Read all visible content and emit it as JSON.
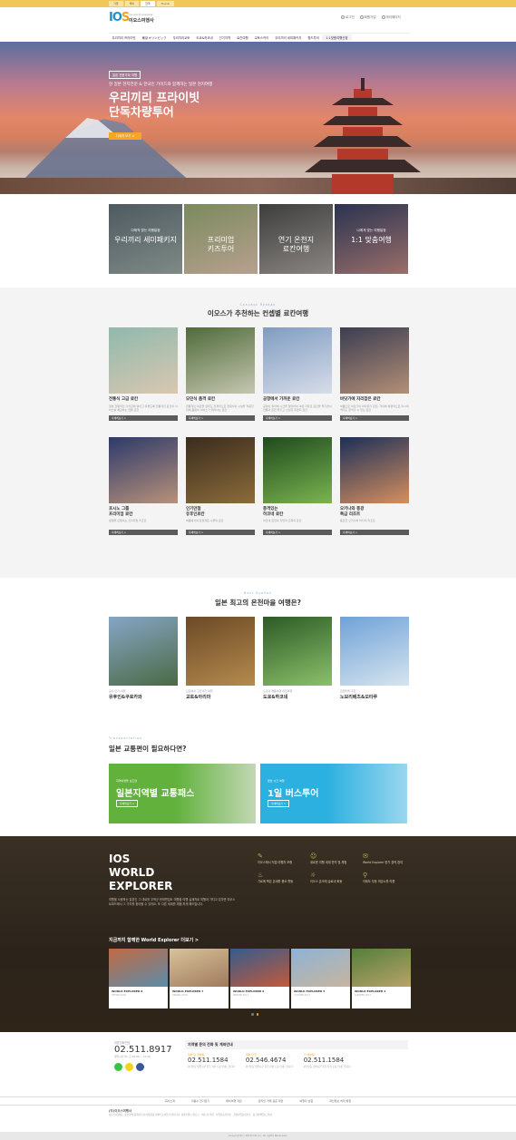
{
  "top_tabs": [
    "기업",
    "해외",
    "한국",
    "Tour/e"
  ],
  "logo": {
    "mark_a": "IO",
    "mark_b": "S",
    "sub1": "ios world explorer",
    "sub2": "이오스여행사"
  },
  "util": [
    "로그인",
    "회원가입",
    "마이페이지"
  ],
  "gnb": [
    "우리끼리 프라이빗",
    "東京オリンピック",
    "우리끼리교토",
    "도쿄&하코네",
    "인기지역",
    "료칸여행",
    "교토스카이",
    "우리끼리 세미패키지",
    "월드투어",
    "1:1맞춤여행신청"
  ],
  "hero": {
    "badge": "일본 전문가와 여행",
    "sub": "현 일본 현지전문 & 한국인 가이드와 함께하는 일본 현지여행",
    "title_l1": "우리끼리 프라이빗",
    "title_l2": "단독차량투어",
    "button": "자세히 보기 >"
  },
  "quick": [
    {
      "l1": "다채적 맞는 여행일정",
      "l2": "우리끼리 세미패키지",
      "c1": "#4d5a60",
      "c2": "#7f8a86"
    },
    {
      "l1": "",
      "l2": "프리미엄\n키즈투어",
      "c1": "#7a8a5c",
      "c2": "#b7a090"
    },
    {
      "l1": "",
      "l2": "연기 온천지\n료칸여행",
      "c1": "#3d3e3d",
      "c2": "#8b8683"
    },
    {
      "l1": "나에게 맞는 여행일정",
      "l2": "1:1 맞춤여행",
      "c1": "#2a3350",
      "c2": "#9a6f6a"
    }
  ],
  "concept": {
    "eyebrow": "Concept Ryokan",
    "title": "이오스가 추천하는 컨셉별 료칸여행",
    "more": "자세히보기 >",
    "cards": [
      {
        "t": "전통식 고급 료칸",
        "d": "일본 전통적인 가치관에 살아고 유물도록 전통적인 료칸의 서비스를 체감하는 전통 료칸",
        "c1": "#8fb9ad",
        "c2": "#d9c7b0"
      },
      {
        "t": "모던식 품격 료칸",
        "d": "전통적인 외관을 살려도 전격적으로 현대식의 시설을 적용한 전체 품원의 서비스가 뛰어나는 료칸",
        "c1": "#4f6b3a",
        "c2": "#c5c6b0"
      },
      {
        "t": "공항에서 가까운 료칸",
        "d": "공항이 위치해 시간을 절약하여 여유 자유로 료칸을 즐기면서 전통과 온천 즐기고 신선한 주변지 료칸",
        "c1": "#7f9cc2",
        "c2": "#d7dde8"
      },
      {
        "t": "바닷가에 자리잡은 료칸",
        "d": "여름으로 바닷가의 바다위기 온천, 저녁에 배경적으로 마시며 맥주도 만끽할 수 있는 료칸",
        "c1": "#3b3d52",
        "c2": "#b38f76"
      },
      {
        "t": "호시노 그룹\n프리미엄 료칸",
        "d": "호텔을 모델이는 프리미엄 리조트",
        "c1": "#2c3a6b",
        "c2": "#b89179"
      },
      {
        "t": "인기만점\n유후인료칸",
        "d": "여름에서의 민정적은 수풀의 료칸",
        "c1": "#3a2c1c",
        "c2": "#8c6c3c"
      },
      {
        "t": "풍격있는\n하코네 료칸",
        "d": "하코네 온천의 자연과 조화의 료칸",
        "c1": "#1f4a1d",
        "c2": "#7bb450"
      },
      {
        "t": "오키나와 풍광\n특급 리조트",
        "d": "풍요한 오키나와 바다의 리조트",
        "c1": "#1c2f59",
        "c2": "#d58f5e"
      }
    ]
  },
  "best": {
    "eyebrow": "Best Ryokan",
    "title": "일본 최고의 온천마을 여행은?",
    "cards": [
      {
        "s": "규슈 인기 여행",
        "n": "유후인&쿠로카와",
        "c1": "#86a5c6",
        "c2": "#4b6a45"
      },
      {
        "s": "교토에서 고즈넉한 여행",
        "n": "교토&아리마",
        "c1": "#6c4a26",
        "c2": "#b48a4e"
      },
      {
        "s": "도쿄의 명품여행 온천여행",
        "n": "도쿄&하코네",
        "c1": "#2d5b26",
        "c2": "#8cc06a"
      },
      {
        "s": "온천마을 추천",
        "n": "노보리베츠&오타루",
        "c1": "#6fa2d8",
        "c2": "#d6e4ee"
      }
    ]
  },
  "transport": {
    "eyebrow": "Transportation",
    "title": "일본 교통편이 필요하다면?",
    "cards": [
      {
        "s": "지역여행을 보조면",
        "n": "일본지역별 교통패스",
        "b": "자세히보기 >",
        "c1": "#61b13c",
        "c2": "#c2d7b4"
      },
      {
        "s": "편안 시간 여행",
        "n": "1일 버스투어",
        "b": "자세히보기 >",
        "c1": "#2bb0e0",
        "c2": "#9ad6ef"
      }
    ]
  },
  "explorer": {
    "brand_l1": "IOS",
    "brand_l2": "WORLD",
    "brand_l3": "EXPLORER",
    "desc": "여행을 사랑하는 일본인 그 대로를 우적군 현재편집도 여행을 여행 실제처로 여행과 가치고 있다면 여오스트피드에서 그 가치를 찾아볼 수 있어요. 또 다른 세계를 체험 하게 해드립니다.",
    "features": [
      {
        "g": "✎",
        "t": "이오스에서 직접 여행자 보증"
      },
      {
        "g": "☺",
        "t": "새로운 여행 세계 만끽 및 체험"
      },
      {
        "g": "✉",
        "t": "World Explorer 한가 경력 참여"
      },
      {
        "g": "♨",
        "t": "기로에 짝은 온세를 풍요 활동"
      },
      {
        "g": "☼",
        "t": "이오스 온오래 슬로내 화동"
      },
      {
        "g": "⚲",
        "t": "이제도 무등 여성시를 여름"
      }
    ],
    "head": "지금까지 함께한 World Explorer 더보기 >",
    "cards": [
      {
        "t": "WORLD EXPLORER 8",
        "d": "TREND 2018",
        "c1": "#c06a43",
        "c2": "#5c8ca9"
      },
      {
        "t": "WORLD EXPLORER 7",
        "d": "SPRING 2018",
        "c1": "#d8c29a",
        "c2": "#9f7a5c"
      },
      {
        "t": "WORLD EXPLORER 6",
        "d": "WINTER 2017",
        "c1": "#355b8c",
        "c2": "#c25a3a"
      },
      {
        "t": "WORLD EXPLORER 5",
        "d": "AUTUMN 2017",
        "c1": "#8eb3d6",
        "c2": "#c7b49e"
      },
      {
        "t": "WORLD EXPLORER 4",
        "d": "SUMMER 2017",
        "c1": "#547f3a",
        "c2": "#b8a26a"
      }
    ]
  },
  "footer": {
    "cs_label": "대표전화번호",
    "cs_phone": "02.511.8917",
    "cs_hours": "영업시간 월~금 10:00 ~ 17:00",
    "regions_title": "지역별 문의 전화 및 계좌안내",
    "regions": [
      {
        "r": "일본 단 개별팀",
        "p": "02.511.1584",
        "a": "외국인등 영업시간 휴무 자유 도움 안내드립니다"
      },
      {
        "r": "일본 단한",
        "p": "02.546.4674",
        "a": "외국인등 영업시간 휴무 자유 도움 안내드립니다"
      },
      {
        "r": "기 해외팀",
        "p": "02.511.1584",
        "a": "외국인등 영업시간 휴무 자유 도움 안내드립니다"
      }
    ],
    "links": [
      "회사소개",
      "이용수 전기로기",
      "해외여행 약관",
      "온라인 거래 표준 약관",
      "여행자 보험",
      "개인정보 처리 방침"
    ],
    "company": "(주)이오스여행사",
    "info": "이오스여행사는 통신판매 중개자로서 여행상품거래의 당사자가 아닙니다. 서울특별시 종로구 · 대표 이 의원 · 사업자등록번호 · 관광사업등록번호 · 통신판매업신고번호",
    "copyright": "Copyright(c) 2018 IOS Co. All rights Reserved."
  }
}
